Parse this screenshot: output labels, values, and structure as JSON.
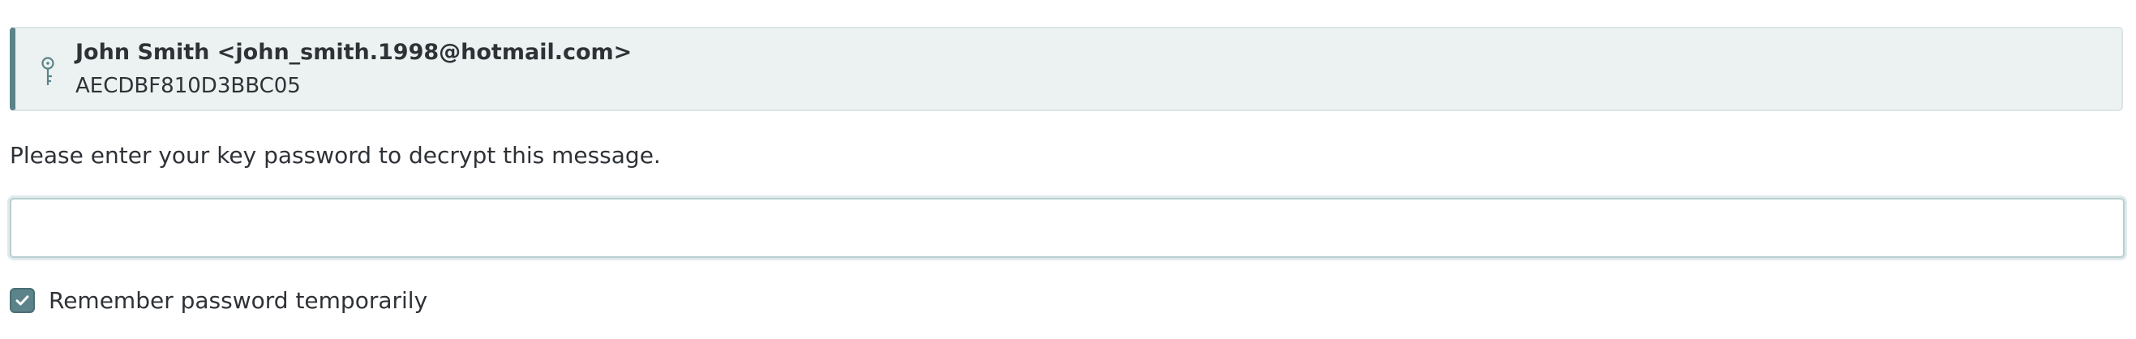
{
  "key": {
    "icon": "key-icon",
    "user_id": "John Smith <john_smith.1998@hotmail.com>",
    "fingerprint": "AECDBF810D3BBC05"
  },
  "prompt": {
    "instruction": "Please enter your key password to decrypt this message."
  },
  "password_field": {
    "value": "",
    "placeholder": ""
  },
  "remember": {
    "label": "Remember password temporarily",
    "checked": true,
    "icon": "check-icon"
  },
  "colors": {
    "accent": "#5b8389",
    "card_background": "#ecf1f1",
    "text": "#2e3236"
  }
}
